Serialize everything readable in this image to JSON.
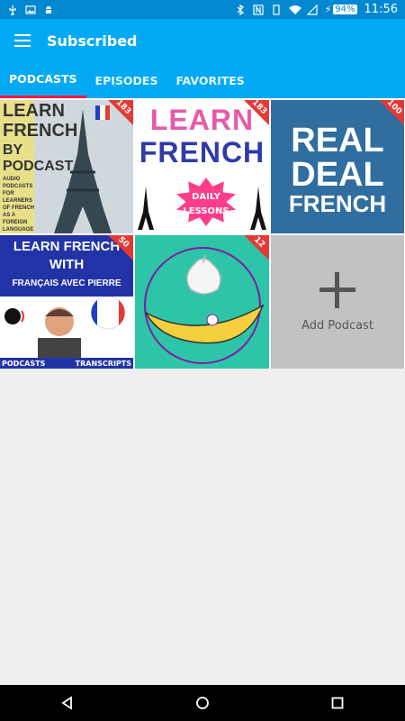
{
  "status": {
    "time": "11:56",
    "battery": "94%"
  },
  "appbar": {
    "title": "Subscribed"
  },
  "tabs": [
    {
      "label": "PODCASTS",
      "active": true
    },
    {
      "label": "EPISODES",
      "active": false
    },
    {
      "label": "FAVORITES",
      "active": false
    }
  ],
  "podcasts": [
    {
      "count": "183",
      "lines": [
        "LEARN",
        "FRENCH",
        "BY",
        "PODCAST"
      ],
      "desc": "AUDIO PODCASTS FOR LEARNERS OF FRENCH AS A FOREIGN LANGUAGE"
    },
    {
      "count": "183",
      "line1": "LEARN",
      "line2": "FRENCH",
      "daily": "DAILY",
      "lessons": "LESSONS"
    },
    {
      "count": "100",
      "lines": [
        "REAL",
        "DEAL",
        "FRENCH"
      ]
    },
    {
      "count": "50",
      "line1": "LEARN FRENCH",
      "line2": "WITH",
      "line3": "FRANÇAIS AVEC PIERRE",
      "foot_left": "PODCASTS",
      "foot_right": "TRANSCRIPTS"
    },
    {
      "count": "12"
    }
  ],
  "add_podcast": {
    "label": "Add Podcast"
  },
  "colors": {
    "primary": "#03a9f4",
    "primary_dark": "#0288d1",
    "tab_indicator": "#ff1744"
  }
}
